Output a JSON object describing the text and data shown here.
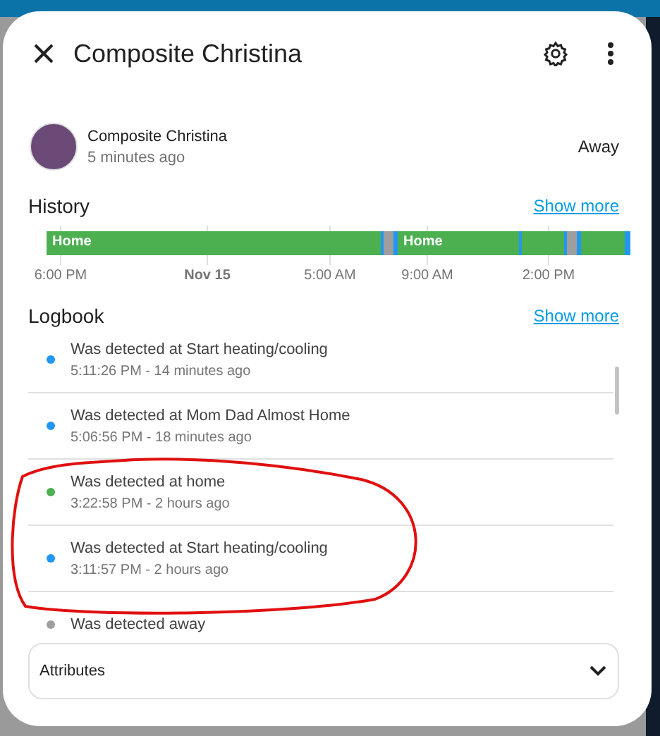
{
  "dialog": {
    "title": "Composite Christina"
  },
  "entity": {
    "name": "Composite Christina",
    "updated": "5 minutes ago",
    "state": "Away"
  },
  "history": {
    "title": "History",
    "show_more": "Show more",
    "bar_labels": [
      "Home",
      "Home"
    ],
    "axis_labels": [
      {
        "label": "6:00 PM",
        "bold": false
      },
      {
        "label": "Nov 15",
        "bold": true
      },
      {
        "label": "5:00 AM",
        "bold": false
      },
      {
        "label": "9:00 AM",
        "bold": false
      },
      {
        "label": "2:00 PM",
        "bold": false
      }
    ]
  },
  "logbook": {
    "title": "Logbook",
    "show_more": "Show more",
    "entries": [
      {
        "message": "Was detected at Start heating/cooling",
        "time": "5:11:26 PM - 14 minutes ago",
        "color": "#2196f3"
      },
      {
        "message": "Was detected at Mom Dad Almost Home",
        "time": "5:06:56 PM - 18 minutes ago",
        "color": "#2196f3"
      },
      {
        "message": "Was detected at home",
        "time": "3:22:58 PM - 2 hours ago",
        "color": "#4caf50"
      },
      {
        "message": "Was detected at Start heating/cooling",
        "time": "3:11:57 PM - 2 hours ago",
        "color": "#2196f3"
      },
      {
        "message": "Was detected away",
        "color": "#9e9e9e"
      }
    ]
  },
  "attributes": {
    "label": "Attributes",
    "expanded": false
  }
}
